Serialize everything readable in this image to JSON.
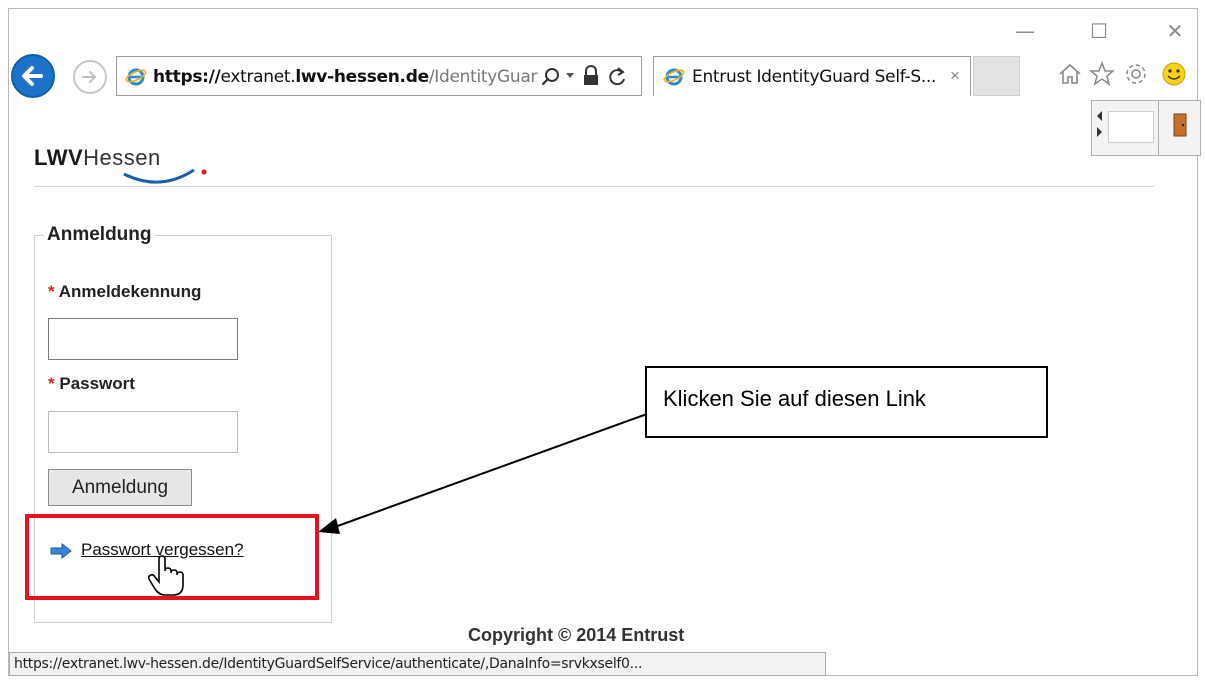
{
  "browser": {
    "address": {
      "scheme": "https://",
      "host_prefix": "extranet.",
      "host_bold": "lwv-hessen.de",
      "path": "/IdentityGuar"
    },
    "tab": {
      "title": "Entrust IdentityGuard Self-S...",
      "close": "×"
    },
    "window_controls": {
      "minimize": "—",
      "maximize": "☐",
      "close": "✕"
    }
  },
  "page": {
    "logo": {
      "bold": "LWV",
      "light": "Hessen"
    },
    "form": {
      "legend": "Anmeldung",
      "required_mark": "*",
      "username_label": "Anmeldekennung",
      "password_label": "Passwort",
      "submit_label": "Anmeldung",
      "forgot_link": "Passwort vergessen?"
    },
    "copyright": "Copyright © 2014 Entrust"
  },
  "annotation": {
    "callout_text": "Klicken Sie auf diesen Link",
    "highlight_color": "#e5131d"
  },
  "statusbar": {
    "url": "https://extranet.lwv-hessen.de/IdentityGuardSelfService/authenticate/,DanaInfo=srvkxself0..."
  },
  "colors": {
    "accent_blue": "#1a73c9",
    "required_red": "#d9201c"
  }
}
